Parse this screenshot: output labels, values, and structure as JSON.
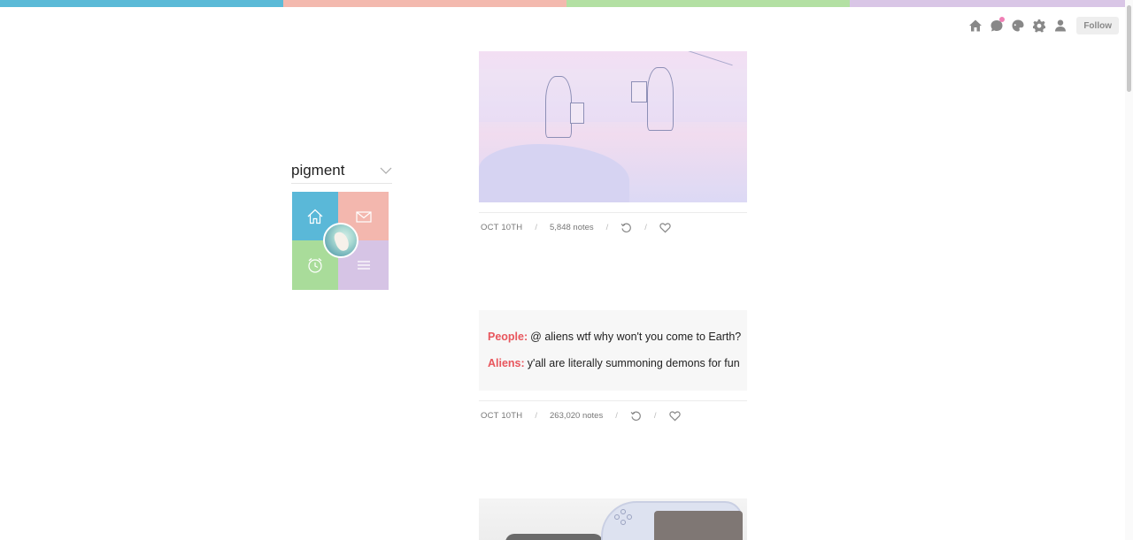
{
  "colors": {
    "bar": [
      "#5bbad7",
      "#f3b9ae",
      "#b3e0a3",
      "#d9c6e6"
    ],
    "chat_label": "#e8565d",
    "tile_home": "#5ab8d8",
    "tile_mail": "#f3b7ae",
    "tile_clock": "#a9dc9a",
    "tile_menu": "#d6c4e5"
  },
  "controls": {
    "icons": [
      "home-icon",
      "chat-icon",
      "palette-icon",
      "gear-icon",
      "user-icon"
    ],
    "follow_label": "Follow"
  },
  "sidebar": {
    "blog_title": "pigment",
    "tiles": [
      "home-icon",
      "mail-icon",
      "clock-icon",
      "menu-icon"
    ]
  },
  "posts": [
    {
      "type": "photo",
      "date": "OCT 10TH",
      "notes": "5,848 notes"
    },
    {
      "type": "chat",
      "lines": [
        {
          "label": "People:",
          "text": "@ aliens wtf why won't you come to Earth?"
        },
        {
          "label": "Aliens:",
          "text": "y'all are literally summoning demons for fun"
        }
      ],
      "date": "OCT 10TH",
      "notes": "263,020 notes"
    },
    {
      "type": "photo"
    }
  ]
}
